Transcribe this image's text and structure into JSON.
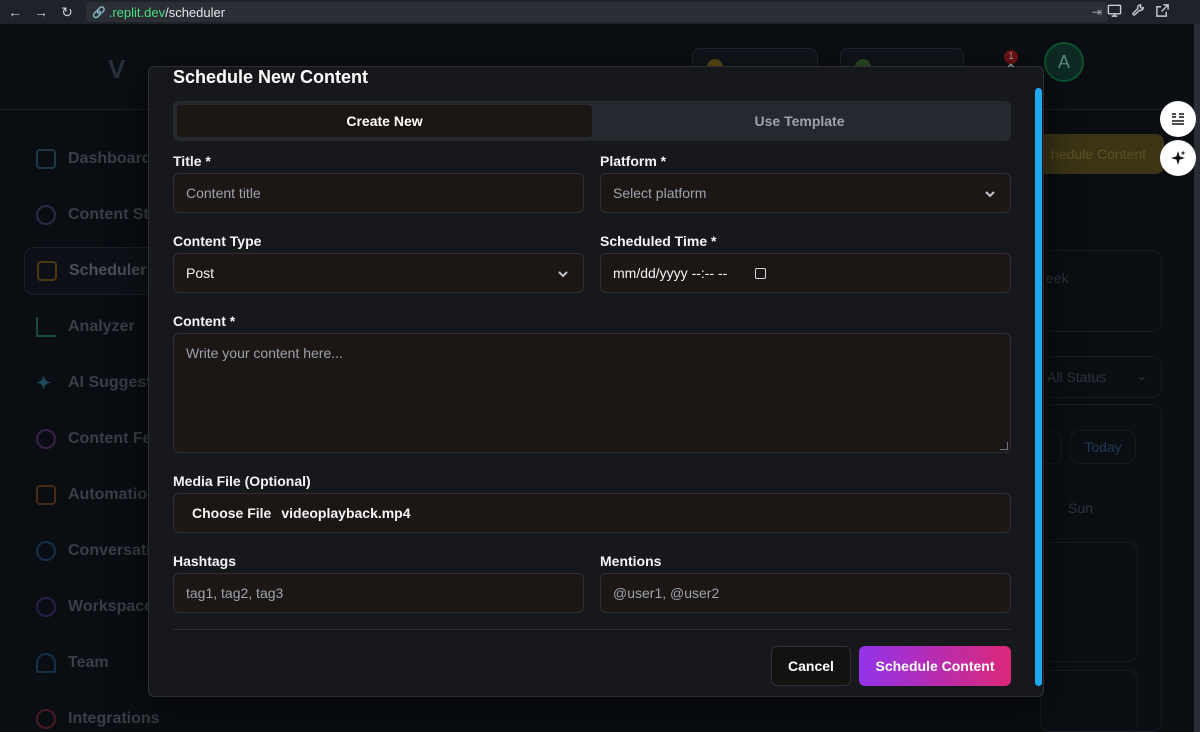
{
  "browser": {
    "url_host": ".replit.dev",
    "url_path": "/scheduler"
  },
  "background": {
    "avatar_initial": "A",
    "notification_count": "1",
    "sidebar_items": [
      {
        "label": "Dashboard",
        "icon": "rocket-icon"
      },
      {
        "label": "Content St",
        "icon": "globe-icon"
      },
      {
        "label": "Scheduler",
        "icon": "calendar-icon"
      },
      {
        "label": "Analyzer",
        "icon": "bar-chart-icon"
      },
      {
        "label": "AI Suggest",
        "icon": "sparkle-icon"
      },
      {
        "label": "Content Fe",
        "icon": "play-icon"
      },
      {
        "label": "Automation",
        "icon": "bot-icon"
      },
      {
        "label": "Conversati",
        "icon": "chat-icon"
      },
      {
        "label": "Workspace",
        "icon": "globe-icon"
      },
      {
        "label": "Team",
        "icon": "users-icon"
      },
      {
        "label": "Integrations",
        "icon": "link-icon"
      }
    ],
    "schedule_button": "hedule Content",
    "week_text": "eek",
    "status_filter": "All Status",
    "today_button": "Today",
    "day_label": "Sun"
  },
  "modal": {
    "title": "Schedule New Content",
    "tabs": [
      {
        "label": "Create New",
        "active": true
      },
      {
        "label": "Use Template",
        "active": false
      }
    ],
    "title_label": "Title *",
    "title_placeholder": "Content title",
    "platform_label": "Platform *",
    "platform_placeholder": "Select platform",
    "content_type_label": "Content Type",
    "content_type_value": "Post",
    "scheduled_time_label": "Scheduled Time *",
    "scheduled_time_value": "mm/dd/yyyy --:-- --",
    "content_label": "Content *",
    "content_placeholder": "Write your content here...",
    "media_label": "Media File (Optional)",
    "choose_file_label": "Choose File",
    "file_name": "videoplayback.mp4",
    "hashtags_label": "Hashtags",
    "hashtags_placeholder": "tag1, tag2, tag3",
    "mentions_label": "Mentions",
    "mentions_placeholder": "@user1, @user2",
    "cancel_label": "Cancel",
    "submit_label": "Schedule Content"
  },
  "colors": {
    "accent_gradient_start": "#9333ea",
    "accent_gradient_end": "#db2777",
    "scrollbar": "#1fa8f0"
  }
}
